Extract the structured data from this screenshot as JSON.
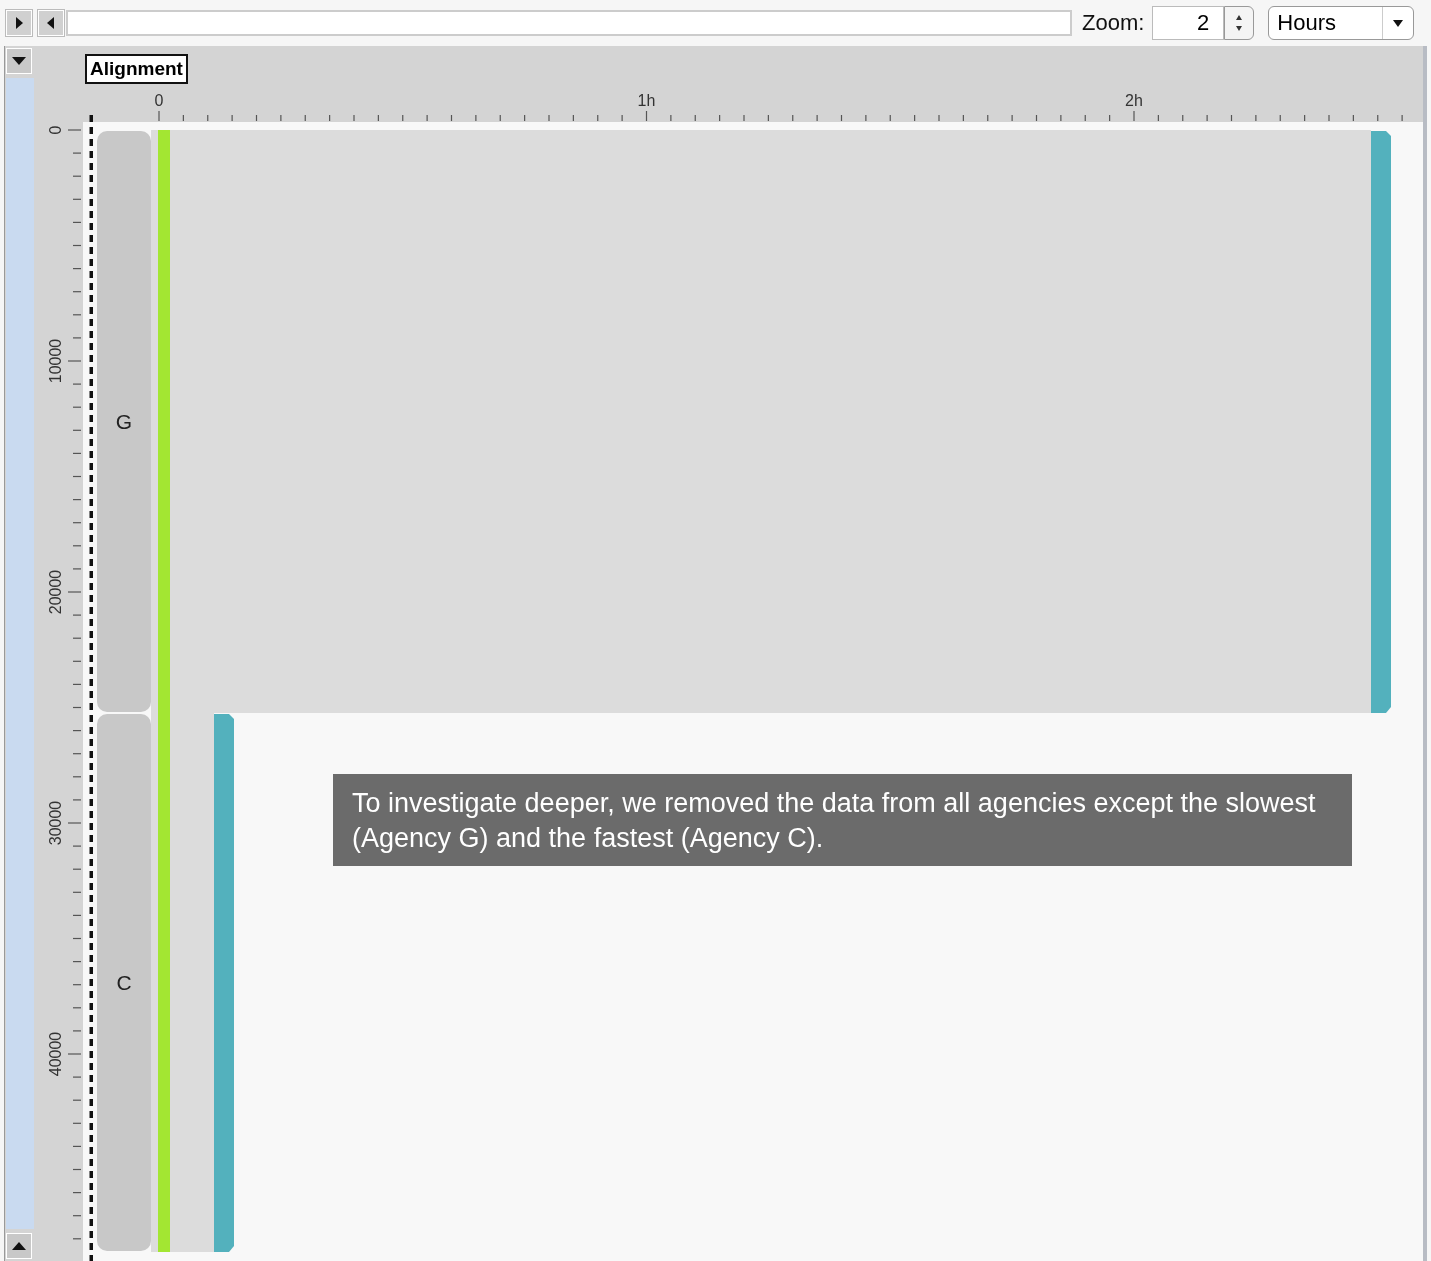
{
  "toolbar": {
    "zoom_label": "Zoom:",
    "zoom_value": "2",
    "unit": "Hours"
  },
  "alignment_label": "Alignment",
  "time_axis": {
    "ticks": [
      "0",
      "1h",
      "2h"
    ]
  },
  "count_axis": {
    "ticks": [
      "0",
      "10000",
      "20000",
      "30000",
      "40000"
    ]
  },
  "rows": [
    {
      "label": "G"
    },
    {
      "label": "C"
    }
  ],
  "annotation": "To investigate deeper, we removed the data from all agencies except the slowest (Agency G) and the fastest (Agency C)."
}
